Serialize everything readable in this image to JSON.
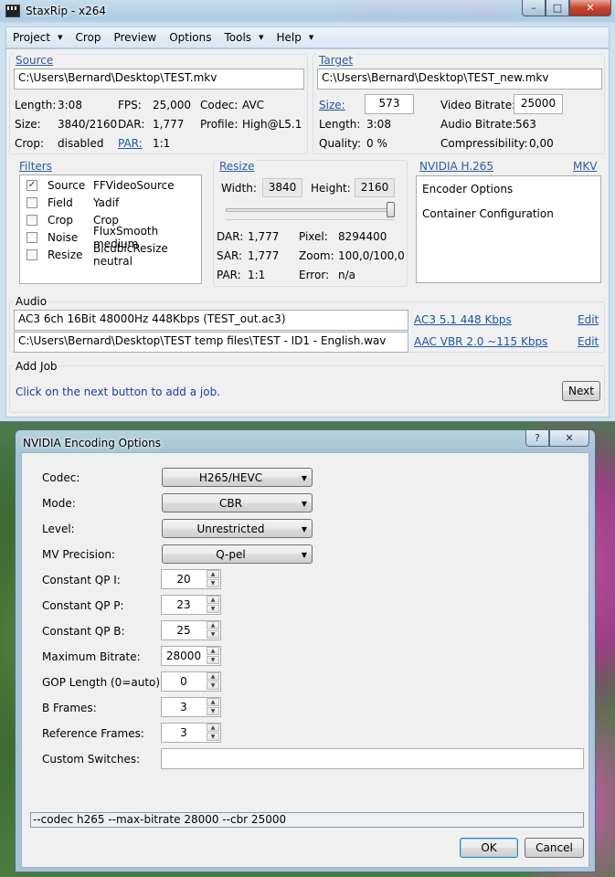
{
  "window": {
    "title": "StaxRip - x264",
    "min": "–",
    "max": "□",
    "close": "✕"
  },
  "menu": {
    "project": "Project",
    "crop": "Crop",
    "preview": "Preview",
    "options": "Options",
    "tools": "Tools",
    "help": "Help",
    "arrow": "▼"
  },
  "source": {
    "title": "Source",
    "path": "C:\\Users\\Bernard\\Desktop\\TEST.mkv",
    "length_label": "Length:",
    "length_value": "3:08",
    "fps_label": "FPS:",
    "fps_value": "25,000",
    "codec_label": "Codec:",
    "codec_value": "AVC",
    "size_label": "Size:",
    "size_value": "3840/2160",
    "dar_label": "DAR:",
    "dar_value": "1,777",
    "profile_label": "Profile:",
    "profile_value": "High@L5.1",
    "crop_label": "Crop:",
    "crop_value": "disabled",
    "par_label": "PAR:",
    "par_value": "1:1"
  },
  "target": {
    "title": "Target",
    "path": "C:\\Users\\Bernard\\Desktop\\TEST_new.mkv",
    "size_label": "Size:",
    "size_value": "573",
    "vbitrate_label": "Video Bitrate:",
    "vbitrate_value": "25000",
    "length_label": "Length:",
    "length_value": "3:08",
    "abitrate_label": "Audio Bitrate:",
    "abitrate_value": "563",
    "quality_label": "Quality:",
    "quality_value": "0 %",
    "compress_label": "Compressibility:",
    "compress_value": "0,00"
  },
  "filters": {
    "title": "Filters",
    "items": [
      {
        "name": "Source",
        "value": "FFVideoSource",
        "check": "✓"
      },
      {
        "name": "Field",
        "value": "Yadif",
        "check": ""
      },
      {
        "name": "Crop",
        "value": "Crop",
        "check": ""
      },
      {
        "name": "Noise",
        "value": "FluxSmooth medium",
        "check": ""
      },
      {
        "name": "Resize",
        "value": "BicubicResize neutral",
        "check": ""
      }
    ]
  },
  "resize": {
    "title": "Resize",
    "width_label": "Width:",
    "width_value": "3840",
    "height_label": "Height:",
    "height_value": "2160",
    "dar_label": "DAR:",
    "dar_value": "1,777",
    "pixel_label": "Pixel:",
    "pixel_value": "8294400",
    "sar_label": "SAR:",
    "sar_value": "1,777",
    "zoom_label": "Zoom:",
    "zoom_value": "100,0/100,0",
    "par_label": "PAR:",
    "par_value": "1:1",
    "error_label": "Error:",
    "error_value": "n/a"
  },
  "encoder": {
    "title": "NVIDIA H.265",
    "container": "MKV",
    "items": [
      "Encoder Options",
      "Container Configuration"
    ]
  },
  "audio": {
    "title": "Audio",
    "track1": "AC3 6ch 16Bit 48000Hz 448Kbps (TEST_out.ac3)",
    "track1_profile": "AC3 5.1 448 Kbps",
    "track2": "C:\\Users\\Bernard\\Desktop\\TEST temp files\\TEST - ID1 - English.wav",
    "track2_profile": "AAC VBR 2.0 ~115 Kbps",
    "edit": "Edit"
  },
  "addjob": {
    "title": "Add Job",
    "hint": "Click on the next button to add a job.",
    "next": "Next"
  },
  "dialog": {
    "title": "NVIDIA Encoding Options",
    "help": "?",
    "close": "✕",
    "codec_label": "Codec:",
    "codec_value": "H265/HEVC",
    "mode_label": "Mode:",
    "mode_value": "CBR",
    "level_label": "Level:",
    "level_value": "Unrestricted",
    "mv_label": "MV Precision:",
    "mv_value": "Q-pel",
    "qpi_label": "Constant QP I:",
    "qpi_value": "20",
    "qpp_label": "Constant QP P:",
    "qpp_value": "23",
    "qpb_label": "Constant QP B:",
    "qpb_value": "25",
    "maxbr_label": "Maximum Bitrate:",
    "maxbr_value": "28000",
    "gop_label": "GOP Length (0=auto):",
    "gop_value": "0",
    "bframes_label": "B Frames:",
    "bframes_value": "3",
    "ref_label": "Reference Frames:",
    "ref_value": "3",
    "custom_label": "Custom Switches:",
    "custom_value": "",
    "cmdline": "--codec h265 --max-bitrate 28000 --cbr 25000",
    "ok": "OK",
    "cancel": "Cancel",
    "up": "▲",
    "down": "▼",
    "dd": "▼"
  }
}
